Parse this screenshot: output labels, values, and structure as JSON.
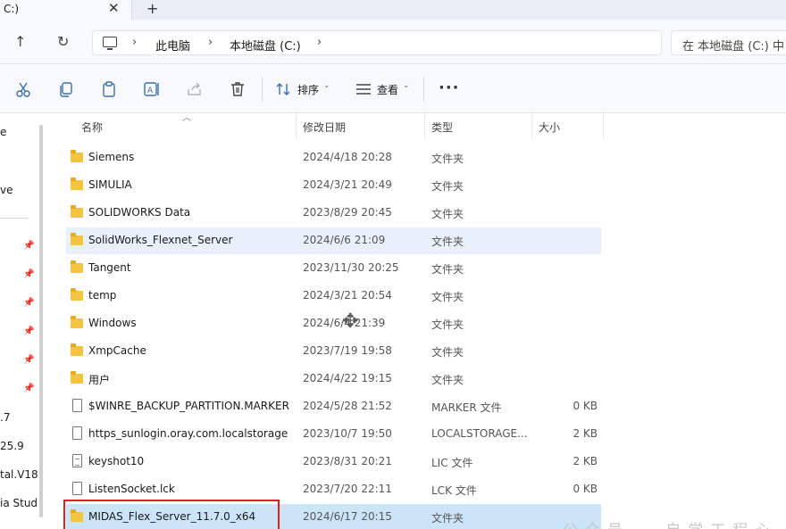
{
  "window": {
    "tab_title": "C:)",
    "tab_close": "✕",
    "tab_add": "+"
  },
  "nav": {
    "up_icon": "↑",
    "refresh_icon": "↻",
    "breadcrumbs": [
      "此电脑",
      "本地磁盘 (C:)"
    ],
    "search_placeholder": "在 本地磁盘 (C:) 中"
  },
  "toolbar": {
    "sort_label": "排序",
    "view_label": "查看",
    "more_label": "···",
    "icons": [
      "cut-icon",
      "copy-icon",
      "paste-icon",
      "rename-icon",
      "share-icon",
      "delete-icon",
      "sort-icon",
      "view-icon"
    ]
  },
  "sidebar": {
    "fragments": [
      "e",
      "ve",
      ".7",
      "25.9",
      "tal.V18",
      "ia Stud"
    ]
  },
  "columns": {
    "name": "名称",
    "date": "修改日期",
    "type": "类型",
    "size": "大小"
  },
  "files": [
    {
      "name": "Siemens",
      "date": "2024/4/18 20:28",
      "type": "文件夹",
      "size": "",
      "kind": "folder"
    },
    {
      "name": "SIMULIA",
      "date": "2024/3/21 20:49",
      "type": "文件夹",
      "size": "",
      "kind": "folder"
    },
    {
      "name": "SOLIDWORKS Data",
      "date": "2023/8/29 20:45",
      "type": "文件夹",
      "size": "",
      "kind": "folder"
    },
    {
      "name": "SolidWorks_Flexnet_Server",
      "date": "2024/6/6 21:09",
      "type": "文件夹",
      "size": "",
      "kind": "folder"
    },
    {
      "name": "Tangent",
      "date": "2023/11/30 20:25",
      "type": "文件夹",
      "size": "",
      "kind": "folder"
    },
    {
      "name": "temp",
      "date": "2024/3/21 20:54",
      "type": "文件夹",
      "size": "",
      "kind": "folder"
    },
    {
      "name": "Windows",
      "date": "2024/6/4 21:39",
      "type": "文件夹",
      "size": "",
      "kind": "folder"
    },
    {
      "name": "XmpCache",
      "date": "2023/7/19 19:58",
      "type": "文件夹",
      "size": "",
      "kind": "folder"
    },
    {
      "name": "用户",
      "date": "2024/4/22 19:15",
      "type": "文件夹",
      "size": "",
      "kind": "folder"
    },
    {
      "name": "$WINRE_BACKUP_PARTITION.MARKER",
      "date": "2024/5/28 21:52",
      "type": "MARKER 文件",
      "size": "0 KB",
      "kind": "file"
    },
    {
      "name": "https_sunlogin.oray.com.localstorage",
      "date": "2023/10/7 19:50",
      "type": "LOCALSTORAGE...",
      "size": "2 KB",
      "kind": "file"
    },
    {
      "name": "keyshot10",
      "date": "2023/8/31 20:21",
      "type": "LIC 文件",
      "size": "2 KB",
      "kind": "file-lines"
    },
    {
      "name": "ListenSocket.lck",
      "date": "2023/7/20 22:11",
      "type": "LCK 文件",
      "size": "0 KB",
      "kind": "file"
    },
    {
      "name": "MIDAS_Flex_Server_11.7.0_x64",
      "date": "2024/6/17 20:15",
      "type": "文件夹",
      "size": "",
      "kind": "folder"
    }
  ],
  "watermark": "公众号 · 自学工程心"
}
